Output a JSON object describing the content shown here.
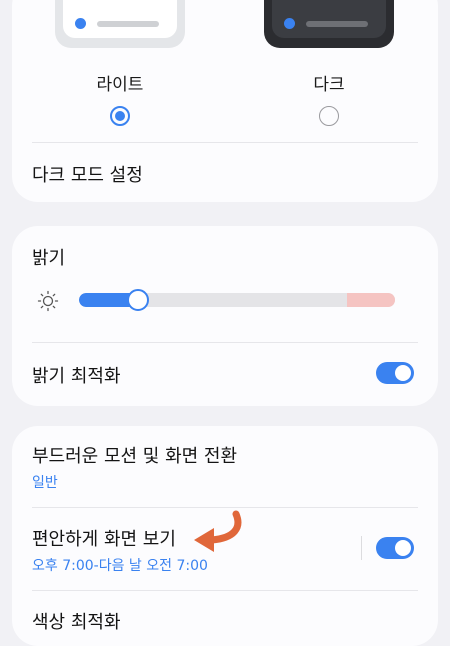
{
  "theme": {
    "light_label": "라이트",
    "dark_label": "다크",
    "selected": "light",
    "dark_mode_settings": "다크 모드 설정"
  },
  "brightness": {
    "title": "밝기",
    "level_fraction": 0.16,
    "optimization_label": "밝기 최적화",
    "optimization_on": true
  },
  "motion": {
    "title": "부드러운 모션 및 화면 전환",
    "subtitle": "일반"
  },
  "eye_comfort": {
    "title": "편안하게 화면 보기",
    "subtitle": "오후 7:00-다음 날 오전 7:00",
    "on": true
  },
  "color_optimization": {
    "title": "색상 최적화"
  },
  "colors": {
    "accent": "#3a82f0",
    "annotation_arrow": "#e0673a",
    "background": "#f1f1f5",
    "card": "#fcfcfe"
  },
  "icons": [
    "sun-icon",
    "radio-selected-icon",
    "radio-unselected-icon",
    "annotation-arrow-icon"
  ]
}
